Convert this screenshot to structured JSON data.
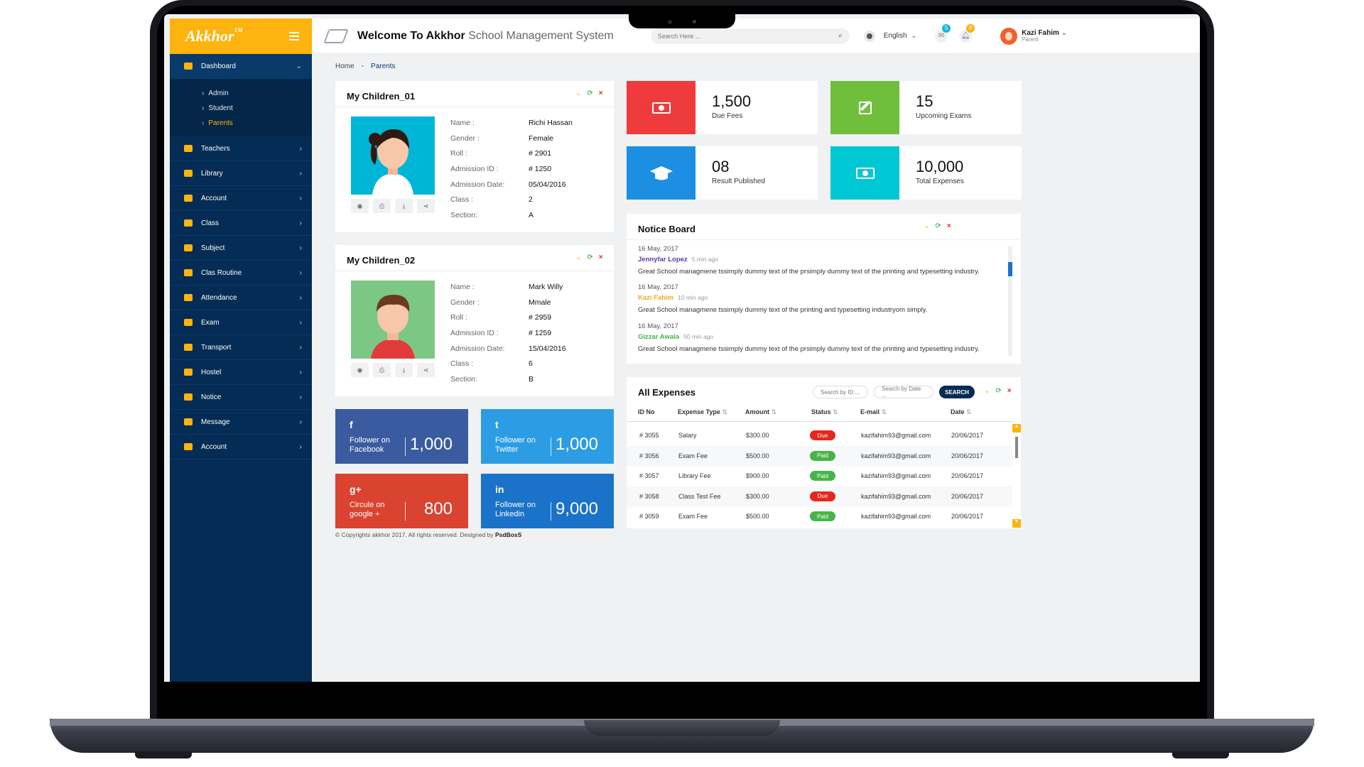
{
  "sidebar": {
    "logo": "Akkhor",
    "logo_tm": "TM",
    "dashboard_label": "Dashboard",
    "sub_items": [
      {
        "label": "Admin"
      },
      {
        "label": "Student"
      },
      {
        "label": "Parents"
      }
    ],
    "items": [
      {
        "label": "Teachers"
      },
      {
        "label": "Library"
      },
      {
        "label": "Account"
      },
      {
        "label": "Class"
      },
      {
        "label": "Subject"
      },
      {
        "label": "Clas Routine"
      },
      {
        "label": "Attendance"
      },
      {
        "label": "Exam"
      },
      {
        "label": "Transport"
      },
      {
        "label": "Hostel"
      },
      {
        "label": "Notice"
      },
      {
        "label": "Message"
      },
      {
        "label": "Account"
      }
    ]
  },
  "header": {
    "welcome_bold": "Welcome To Akkhor",
    "welcome_light": "School Management System",
    "search_placeholder": "Search Here ...",
    "language": "English",
    "messages_count": "5",
    "notifications_count": "8",
    "user_name": "Kazi Fahim",
    "user_role": "Parent"
  },
  "breadcrumb": {
    "home": "Home",
    "current": "Parents"
  },
  "children": [
    {
      "title": "My Children_01",
      "fields": [
        {
          "k": "Name :",
          "v": "Richi Hassan"
        },
        {
          "k": "Gender :",
          "v": "Female"
        },
        {
          "k": "Roll :",
          "v": "# 2901"
        },
        {
          "k": "Admission ID :",
          "v": "# 1250"
        },
        {
          "k": "Admission Date:",
          "v": "05/04/2016"
        },
        {
          "k": "Class :",
          "v": "2"
        },
        {
          "k": "Section:",
          "v": "A"
        }
      ]
    },
    {
      "title": "My Children_02",
      "fields": [
        {
          "k": "Name :",
          "v": "Mark Willy"
        },
        {
          "k": "Gender :",
          "v": "Mmale"
        },
        {
          "k": "Roll :",
          "v": "# 2959"
        },
        {
          "k": "Admission ID :",
          "v": "# 1259"
        },
        {
          "k": "Admission Date:",
          "v": "15/04/2016"
        },
        {
          "k": "Class :",
          "v": "6"
        },
        {
          "k": "Section:",
          "v": "B"
        }
      ]
    }
  ],
  "stats": [
    {
      "value": "1,500",
      "label": "Due Fees",
      "color": "#ef3b3b"
    },
    {
      "value": "15",
      "label": "Upcoming Exams",
      "color": "#6fbf3d"
    },
    {
      "value": "08",
      "label": "Result Published",
      "color": "#1c8fe3"
    },
    {
      "value": "10,000",
      "label": "Total Expenses",
      "color": "#00c7d4"
    }
  ],
  "notice_board": {
    "title": "Notice Board",
    "entries": [
      {
        "date": "16 May, 2017",
        "author": "Jennyfar Lopez",
        "ago": "5 min ago",
        "color": "#5a3aa8",
        "text": "Great School managmene tssimply dummy text of the prsimply dummy text of the printing and typesetting industry."
      },
      {
        "date": "16 May, 2017",
        "author": "Kazi Fahim",
        "ago": "10 min ago",
        "color": "#f5a623",
        "text": "Great School managmene tssimply dummy text of the printing and typesetting industryom simply."
      },
      {
        "date": "16 May, 2017",
        "author": "Gizzar Awala",
        "ago": "50 min ago",
        "color": "#47b449",
        "text": "Great School managmene tssimply dummy text of the prsimply dummy text of the printing and typesetting industry."
      }
    ]
  },
  "expenses": {
    "title": "All Expenses",
    "search_id_ph": "Search by ID ...",
    "search_date_ph": "Search by Date ...",
    "search_btn": "SEARCH",
    "headers": [
      "ID No",
      "Expense Type",
      "Amount",
      "Status",
      "E-mail",
      "Date"
    ],
    "rows": [
      {
        "id": "# 3055",
        "type": "Salary",
        "amount": "$300.00",
        "status": "Due",
        "email": "kazifahim93@gmail.com",
        "date": "20/06/2017"
      },
      {
        "id": "# 3056",
        "type": "Exam Fee",
        "amount": "$500.00",
        "status": "Paid",
        "email": "kazifahim93@gmail.com",
        "date": "20/06/2017"
      },
      {
        "id": "# 3057",
        "type": "Library Fee",
        "amount": "$900.00",
        "status": "Paid",
        "email": "kazifahim93@gmail.com",
        "date": "20/06/2017"
      },
      {
        "id": "# 3058",
        "type": "Class Test Fee",
        "amount": "$300.00",
        "status": "Due",
        "email": "kazifahim93@gmail.com",
        "date": "20/06/2017"
      },
      {
        "id": "# 3059",
        "type": "Exam Fee",
        "amount": "$500.00",
        "status": "Paid",
        "email": "kazifahim93@gmail.com",
        "date": "20/06/2017"
      }
    ]
  },
  "social": [
    {
      "icon": "f",
      "label": "Follower on Facebook",
      "value": "1,000",
      "color": "#3a5ba0",
      "name": "facebook"
    },
    {
      "icon": "t",
      "label": "Follower on Twitter",
      "value": "1,000",
      "color": "#2c9de4",
      "name": "twitter"
    },
    {
      "icon": "g+",
      "label": "Circule on google +",
      "value": "800",
      "color": "#d9432f",
      "name": "google-plus"
    },
    {
      "icon": "in",
      "label": "Follower on Linkedin",
      "value": "9,000",
      "color": "#1a72c9",
      "name": "linkedin"
    }
  ],
  "footer": {
    "text": "© Copyrights akkhor 2017. All rights reserved. Designed by ",
    "designer": "PsdBosS"
  }
}
